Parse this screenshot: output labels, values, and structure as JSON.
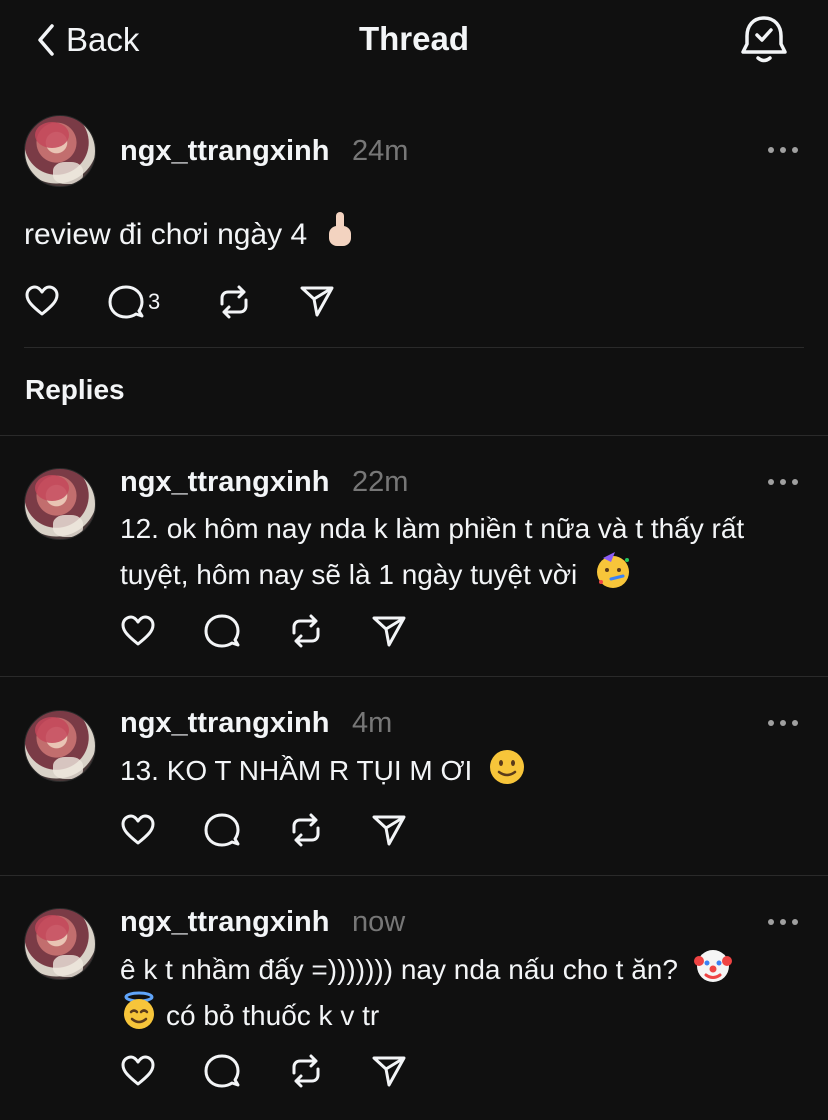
{
  "nav": {
    "back_label": "Back",
    "title": "Thread"
  },
  "post": {
    "username": "ngx_ttrangxinh",
    "time": "24m",
    "text": "review đi chơi ngày 4",
    "reply_count": "3"
  },
  "replies_heading": "Replies",
  "replies": [
    {
      "username": "ngx_ttrangxinh",
      "time": "22m",
      "line1": "12. ok hôm nay nda k làm phiền t nữa và t thấy rất",
      "line2": "tuyệt, hôm nay sẽ là 1 ngày tuyệt vời"
    },
    {
      "username": "ngx_ttrangxinh",
      "time": "4m",
      "line1": "13. KO T NHẦM R TỤI M ƠI"
    },
    {
      "username": "ngx_ttrangxinh",
      "time": "now",
      "line1": "ê k t nhầm đấy =))))))) nay nda nấu cho t ăn?",
      "line2": "có bỏ thuốc k v tr"
    }
  ],
  "icons": {
    "back": "chevron-left-icon",
    "bell": "bell-check-icon",
    "like": "heart-icon",
    "comment": "comment-icon",
    "repost": "repost-icon",
    "share": "send-icon",
    "more": "more-icon"
  },
  "colors": {
    "background": "#101010",
    "text": "#f3f5f7",
    "muted": "#777777",
    "divider": "#2a2a2a"
  }
}
